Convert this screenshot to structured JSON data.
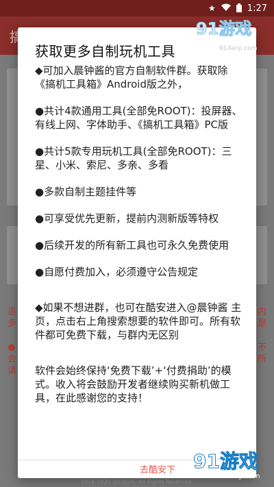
{
  "status_bar": {
    "time": "1:27",
    "icons": [
      "star-icon",
      "wifi-icon",
      "battery-icon"
    ]
  },
  "background": {
    "app_title": "搞",
    "red_lines_left": [
      "退",
      "多",
      "●",
      "会",
      "请"
    ],
    "red_lines_right": [
      "内",
      "是",
      "不",
      "所"
    ],
    "footer": "2016-2020 @CzJam. All Rights Reserved."
  },
  "dialog": {
    "title": "获取更多自制玩机工具",
    "paragraphs": [
      "◆可加入晨钟酱的官方自制软件群。获取除《搞机工具箱》Android版之外，",
      "●共计4款通用工具(全部免ROOT)：投屏器、有线上网、字体助手、《搞机工具箱》PC版",
      "●共计5款专用玩机工具(全部免ROOT)：三星、小米、索尼、多亲、多看",
      "●多款自制主题挂件等",
      "●可享受优先更新，提前内测新版等特权",
      "●后续开发的所有新工具也可永久免费使用",
      "●自愿付费加入，必须遵守公告规定",
      "◆如果不想进群，也可在酷安进入@晨钟酱 主页，点击右上角搜索想要的软件即可。所有软件都可免费下载，与群内无区别",
      "软件会始终保持‘免费下载’+‘付费捐助’的模式。收入将会鼓励开发者继续购买新机做工具，在此感谢您的支持！"
    ],
    "action_label": "去酷安下"
  },
  "watermark": {
    "brand": "91游戏",
    "site": "91danji.com"
  },
  "colors": {
    "status_bar": "#6e1f1c",
    "app_bar": "#8a2e2a",
    "dialog_bg": "#ffffff",
    "action": "#e45b52"
  }
}
